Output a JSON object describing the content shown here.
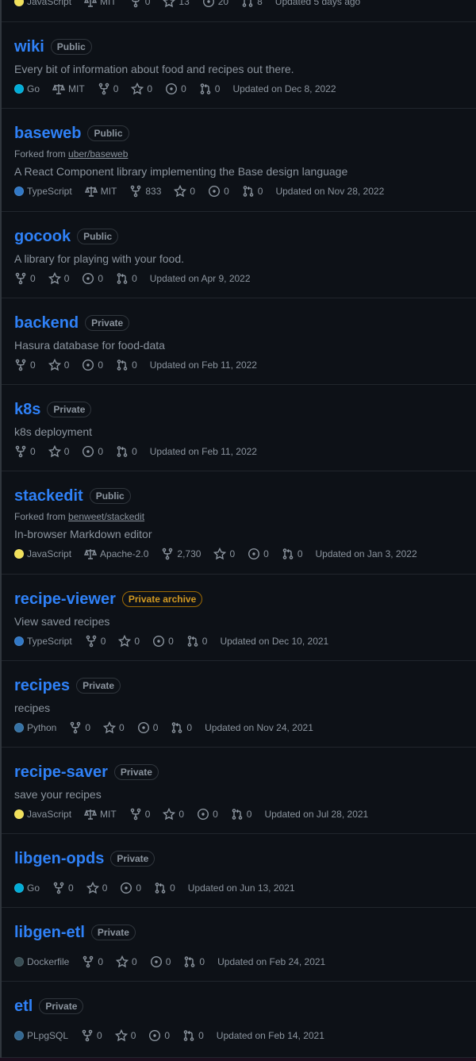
{
  "colors": {
    "link": "#2f81f7",
    "text_muted": "#8b949e",
    "bg": "#0d1117",
    "border": "#30363d",
    "archive": "#d29922",
    "lang_JavaScript": "#f1e05a",
    "lang_Go": "#00ADD8",
    "lang_TypeScript": "#3178c6",
    "lang_Python": "#3572A5",
    "lang_Dockerfile": "#384d54",
    "lang_PLpgSQL": "#336790"
  },
  "top_partial": {
    "language": "JavaScript",
    "license": "MIT",
    "forks": "0",
    "stars": "13",
    "issues": "20",
    "prs": "8",
    "updated": "Updated 5 days ago"
  },
  "repos": [
    {
      "name": "wiki",
      "visibility": "Public",
      "description": "Every bit of information about food and recipes out there.",
      "language": "Go",
      "license": "MIT",
      "forks": "0",
      "stars": "0",
      "issues": "0",
      "prs": "0",
      "updated": "Updated on Dec 8, 2022"
    },
    {
      "name": "baseweb",
      "visibility": "Public",
      "forked_prefix": "Forked from ",
      "forked_from": "uber/baseweb",
      "description": "A React Component library implementing the Base design language",
      "language": "TypeScript",
      "license": "MIT",
      "forks": "833",
      "stars": "0",
      "issues": "0",
      "prs": "0",
      "updated": "Updated on Nov 28, 2022"
    },
    {
      "name": "gocook",
      "visibility": "Public",
      "description": "A library for playing with your food.",
      "forks": "0",
      "stars": "0",
      "issues": "0",
      "prs": "0",
      "updated": "Updated on Apr 9, 2022"
    },
    {
      "name": "backend",
      "visibility": "Private",
      "description": "Hasura database for food-data",
      "forks": "0",
      "stars": "0",
      "issues": "0",
      "prs": "0",
      "updated": "Updated on Feb 11, 2022"
    },
    {
      "name": "k8s",
      "visibility": "Private",
      "description": "k8s deployment",
      "forks": "0",
      "stars": "0",
      "issues": "0",
      "prs": "0",
      "updated": "Updated on Feb 11, 2022"
    },
    {
      "name": "stackedit",
      "visibility": "Public",
      "forked_prefix": "Forked from ",
      "forked_from": "benweet/stackedit",
      "description": "In-browser Markdown editor",
      "language": "JavaScript",
      "license": "Apache-2.0",
      "forks": "2,730",
      "stars": "0",
      "issues": "0",
      "prs": "0",
      "updated": "Updated on Jan 3, 2022"
    },
    {
      "name": "recipe-viewer",
      "visibility": "Private archive",
      "description": "View saved recipes",
      "language": "TypeScript",
      "forks": "0",
      "stars": "0",
      "issues": "0",
      "prs": "0",
      "updated": "Updated on Dec 10, 2021"
    },
    {
      "name": "recipes",
      "visibility": "Private",
      "description": "recipes",
      "language": "Python",
      "forks": "0",
      "stars": "0",
      "issues": "0",
      "prs": "0",
      "updated": "Updated on Nov 24, 2021"
    },
    {
      "name": "recipe-saver",
      "visibility": "Private",
      "description": "save your recipes",
      "language": "JavaScript",
      "license": "MIT",
      "forks": "0",
      "stars": "0",
      "issues": "0",
      "prs": "0",
      "updated": "Updated on Jul 28, 2021"
    },
    {
      "name": "libgen-opds",
      "visibility": "Private",
      "language": "Go",
      "forks": "0",
      "stars": "0",
      "issues": "0",
      "prs": "0",
      "updated": "Updated on Jun 13, 2021"
    },
    {
      "name": "libgen-etl",
      "visibility": "Private",
      "language": "Dockerfile",
      "forks": "0",
      "stars": "0",
      "issues": "0",
      "prs": "0",
      "updated": "Updated on Feb 24, 2021"
    },
    {
      "name": "etl",
      "visibility": "Private",
      "language": "PLpgSQL",
      "forks": "0",
      "stars": "0",
      "issues": "0",
      "prs": "0",
      "updated": "Updated on Feb 14, 2021"
    }
  ]
}
